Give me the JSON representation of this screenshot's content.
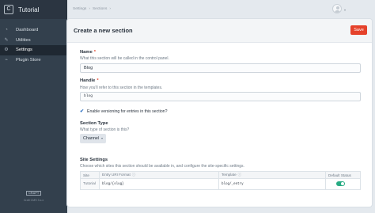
{
  "sidebar": {
    "brand_initial": "C",
    "brand_name": "Tutorial",
    "items": [
      {
        "label": "Dashboard",
        "icon": "gauge-icon"
      },
      {
        "label": "Utilities",
        "icon": "wrench-icon"
      },
      {
        "label": "Settings",
        "icon": "gear-icon",
        "active": true
      },
      {
        "label": "Plugin Store",
        "icon": "plug-icon"
      }
    ],
    "craft_badge": "CRAFT",
    "edition": "Craft CMS 3.x.x"
  },
  "breadcrumb": [
    "Settings",
    "›",
    "Sections",
    "›"
  ],
  "header": {
    "title": "Create a new section",
    "save_label": "Save"
  },
  "form": {
    "name": {
      "label": "Name",
      "required_mark": "*",
      "instructions": "What this section will be called in the control panel.",
      "value": "Blog"
    },
    "handle": {
      "label": "Handle",
      "required_mark": "*",
      "instructions": "How you'll refer to this section in the templates.",
      "value": "blog"
    },
    "versioning": {
      "label": "Enable versioning for entries in this section?",
      "checked": true
    },
    "section_type": {
      "label": "Section Type",
      "instructions": "What type of section is this?",
      "value": "Channel"
    },
    "site_settings": {
      "label": "Site Settings",
      "instructions": "Choose which sites this section should be available in, and configure the site-specific settings.",
      "columns": [
        "Site",
        "Entry URI Format",
        "Template",
        "Default Status"
      ],
      "rows": [
        {
          "site": "Tutorial",
          "uri_format": "blog/{slug}",
          "template": "blog/_entry",
          "default_status": true
        }
      ]
    }
  },
  "colors": {
    "accent": "#e5422b",
    "toggle_on": "#27ab83",
    "sidebar": "#33404d"
  }
}
